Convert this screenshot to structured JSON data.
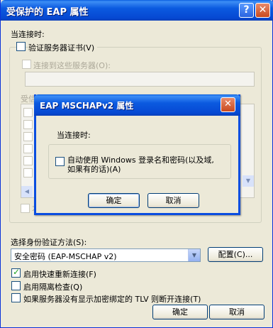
{
  "window": {
    "title": "受保护的 EAP 属性",
    "help_label": "?",
    "close_label": "✕"
  },
  "main": {
    "when_connecting": "当连接时:",
    "verify_cert_label": "验证服务器证书(V)",
    "connect_servers_label": "连接到这些服务器(O):",
    "trusted_root_label": "受信",
    "no_prompt_label": "不",
    "auth_method_label": "选择身份验证方法(S):",
    "auth_method_value": "安全密码 (EAP-MSCHAP v2)",
    "config_button": "配置(C)...",
    "fast_reconnect_label": "启用快速重新连接(F)",
    "quarantine_label": "启用隔离检查(Q)",
    "tlv_label": "如果服务器没有显示加密绑定的 TLV 则断开连接(T)",
    "ok_button": "确定",
    "cancel_button": "取消"
  },
  "dialog": {
    "title": "EAP MSCHAPv2 属性",
    "close_label": "✕",
    "when_connecting": "当连接时:",
    "auto_windows_line1": "自动使用 Windows 登录名和密码(以及域,",
    "auto_windows_line2": "如果有的话)(A)",
    "ok_button": "确定",
    "cancel_button": "取消"
  },
  "state": {
    "verify_cert_checked": false,
    "fast_reconnect_checked": true,
    "quarantine_checked": false,
    "tlv_checked": false,
    "auto_windows_checked": false
  }
}
